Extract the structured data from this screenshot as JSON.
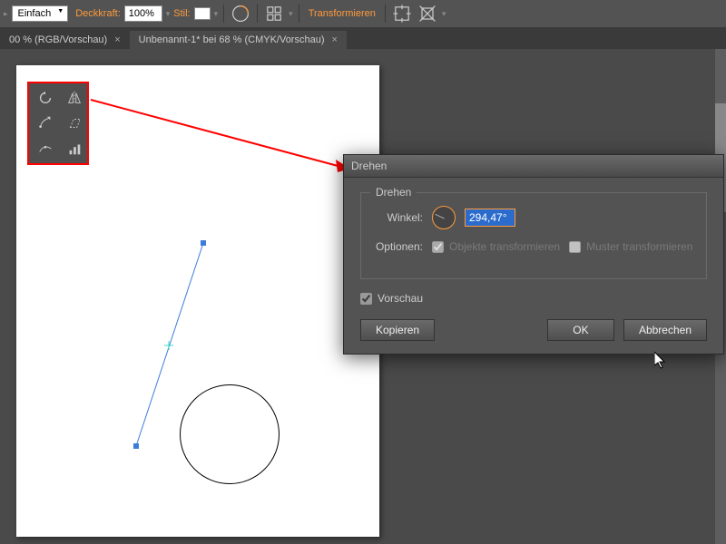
{
  "toolbar": {
    "basic_dropdown": "Einfach",
    "opacity_label": "Deckkraft:",
    "opacity_value": "100%",
    "style_label": "Stil:",
    "transform_link": "Transformieren"
  },
  "tabs": [
    {
      "label": "00 % (RGB/Vorschau)"
    },
    {
      "label": "Unbenannt-1* bei 68 % (CMYK/Vorschau)"
    }
  ],
  "tool_icons": [
    "rotate-icon",
    "reflect-icon",
    "scale-icon",
    "shear-icon",
    "reshape-icon",
    "graph-icon"
  ],
  "dialog": {
    "title": "Drehen",
    "group_label": "Drehen",
    "angle_label": "Winkel:",
    "angle_value": "294,47°",
    "options_label": "Optionen:",
    "opt_transform_objects": "Objekte transformieren",
    "opt_transform_patterns": "Muster transformieren",
    "preview_label": "Vorschau",
    "btn_copy": "Kopieren",
    "btn_ok": "OK",
    "btn_cancel": "Abbrechen"
  }
}
